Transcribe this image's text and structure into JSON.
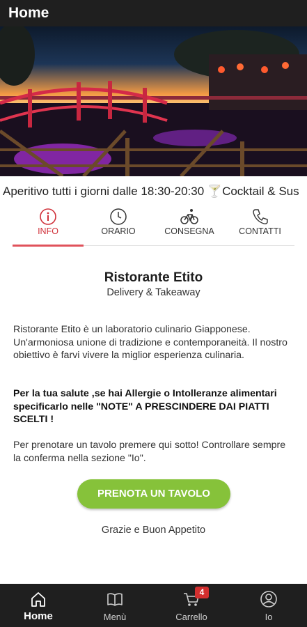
{
  "header": {
    "title": "Home"
  },
  "ticker": {
    "text": "Aperitivo tutti i giorni dalle 18:30-20:30 🍸Cocktail & Sus"
  },
  "tabs": [
    {
      "label": "INFO",
      "icon": "info-icon"
    },
    {
      "label": "ORARIO",
      "icon": "clock-icon"
    },
    {
      "label": "CONSEGNA",
      "icon": "bicycle-icon"
    },
    {
      "label": "CONTATTI",
      "icon": "phone-icon"
    }
  ],
  "info": {
    "title": "Ristorante Etito",
    "subtitle": "Delivery & Takeaway",
    "paragraph1": "Ristorante Etito è un laboratorio culinario Giapponese. Un'armoniosa unione di tradizione e contemporaneità. Il nostro obiettivo è farvi vivere la miglior esperienza culinaria.",
    "paragraph2": "Per la tua salute ,se hai Allergie o Intolleranze alimentari specificarlo nelle \"NOTE\" A PRESCINDERE DAI PIATTI SCELTI !",
    "paragraph3": "Per prenotare un tavolo premere qui sotto! Controllare sempre la conferma nella sezione \"Io\".",
    "book_button": "PRENOTA UN TAVOLO",
    "thanks": "Grazie e Buon Appetito"
  },
  "bottom_nav": {
    "home": "Home",
    "menu": "Menù",
    "cart": "Carrello",
    "cart_count": "4",
    "profile": "Io"
  },
  "colors": {
    "accent_red": "#d0313a",
    "button_green": "#86c23a",
    "bar_dark": "#1f1f1f"
  }
}
